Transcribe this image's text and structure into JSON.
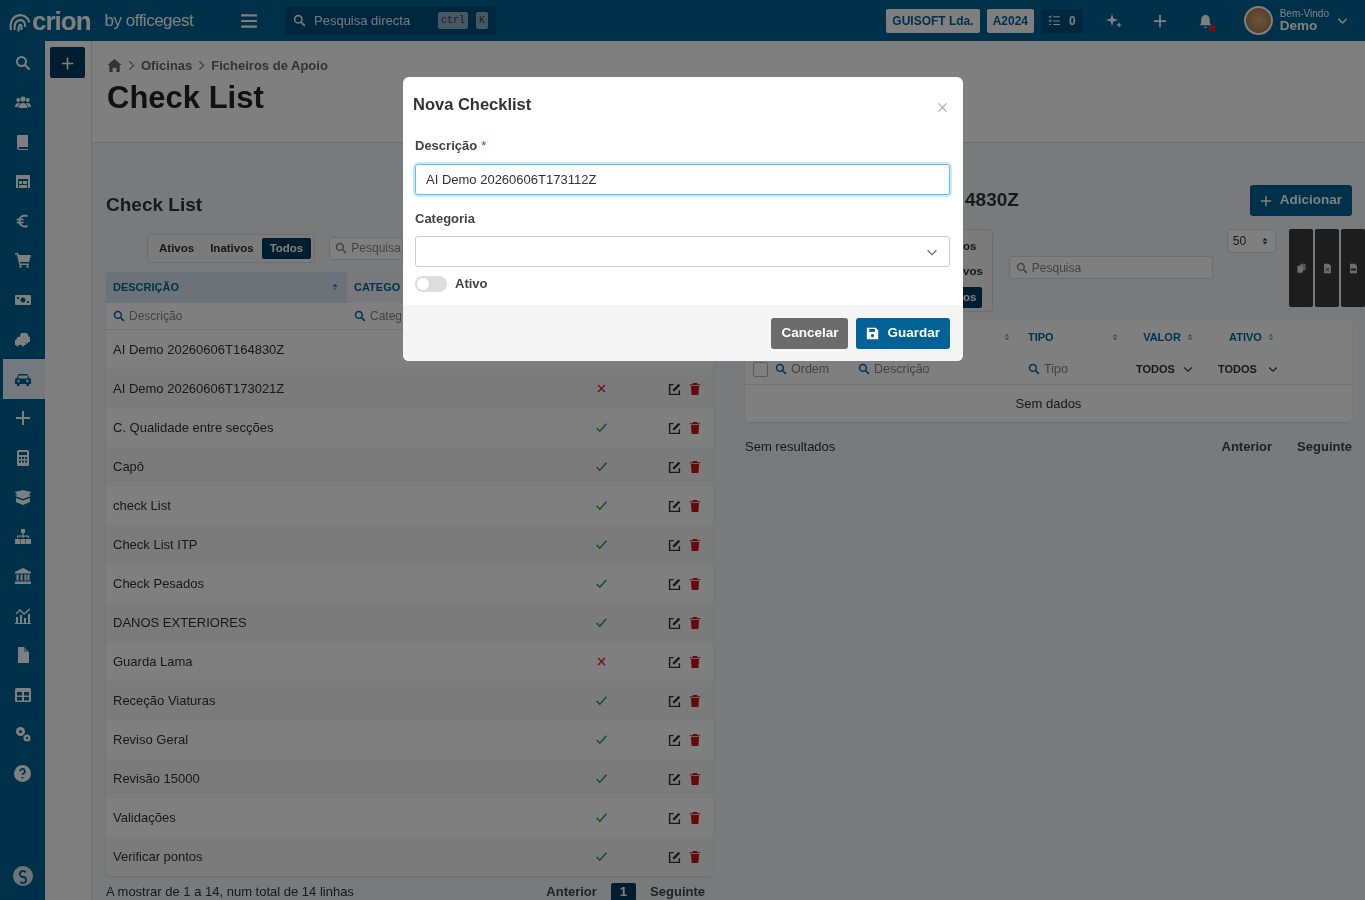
{
  "topbar": {
    "logo": "crion",
    "logo_sub": "by officegest",
    "search": {
      "placeholder": "Pesquisa directa",
      "keys": [
        "ctrl",
        "K"
      ]
    },
    "company": "GUISOFT Lda.",
    "year": "A2024",
    "tasks": "0",
    "unread_notifications": true,
    "greeting": "Bem-Vindo",
    "user": "Demo"
  },
  "sidebar": {
    "items": [
      {
        "kind": "search",
        "selected": false
      },
      {
        "kind": "users",
        "selected": false
      },
      {
        "kind": "book",
        "selected": false
      },
      {
        "kind": "warehouse",
        "selected": false
      },
      {
        "kind": "euro",
        "selected": false
      },
      {
        "kind": "cart",
        "selected": false
      },
      {
        "kind": "banknote",
        "selected": false
      },
      {
        "kind": "cars",
        "selected": false
      },
      {
        "kind": "car",
        "selected": true
      },
      {
        "kind": "plus",
        "selected": false
      },
      {
        "kind": "calculator",
        "selected": false
      },
      {
        "kind": "box",
        "selected": false
      },
      {
        "kind": "sitemap",
        "selected": false
      },
      {
        "kind": "bank",
        "selected": false
      },
      {
        "kind": "chart",
        "selected": false
      },
      {
        "kind": "file",
        "selected": false
      },
      {
        "kind": "table",
        "selected": false
      },
      {
        "kind": "gears",
        "selected": false
      },
      {
        "kind": "help",
        "selected": false
      }
    ]
  },
  "breadcrumb": [
    "Oficinas",
    "Ficheiros de Apoio"
  ],
  "page_title": "Check List",
  "left_panel": {
    "title": "Check List",
    "filters": [
      {
        "label": "Ativos",
        "selected": false
      },
      {
        "label": "Inativos",
        "selected": false
      },
      {
        "label": "Todos",
        "selected": true
      }
    ],
    "search": {
      "placeholder": "Pesquisa"
    },
    "columns": [
      {
        "label": "DESCRIÇÃO",
        "sorted": true
      },
      {
        "label": "CATEGO",
        "sorted": false
      }
    ],
    "column_filters": [
      "Descrição",
      "Categ"
    ],
    "rows": [
      {
        "description": "AI Demo 20260606T164830Z"
      },
      {
        "description": "AI Demo 20260606T173021Z",
        "active": false
      },
      {
        "description": "C. Qualidade entre secções",
        "active": true
      },
      {
        "description": "Capô",
        "active": true
      },
      {
        "description": "check List",
        "active": true
      },
      {
        "description": "Check List ITP",
        "active": true
      },
      {
        "description": "Check Pesados",
        "active": true
      },
      {
        "description": "DANOS EXTERIORES",
        "active": true
      },
      {
        "description": "Guarda Lama",
        "active": false
      },
      {
        "description": "Receção Viaturas",
        "active": true
      },
      {
        "description": "Reviso Geral",
        "active": true
      },
      {
        "description": "Revisão 15000",
        "active": true
      },
      {
        "description": "Validações",
        "active": true
      },
      {
        "description": "Verificar pontos",
        "active": true
      }
    ],
    "summary": "A mostrar de 1 a 14, num total de 14 linhas",
    "previous": "Anterior",
    "pages": [
      {
        "label": "1",
        "selected": true
      }
    ],
    "next": "Seguinte"
  },
  "right_panel": {
    "title": "4830Z",
    "add_button": "Adicionar",
    "filters": [
      {
        "label": "os",
        "selected": false
      },
      {
        "label": "vos",
        "selected": false
      },
      {
        "label": "os",
        "selected": true
      }
    ],
    "search": {
      "placeholder": "Pesquisa"
    },
    "page_size": "50",
    "exports": [
      {
        "kind": "copy"
      },
      {
        "kind": "excel"
      },
      {
        "kind": "csv"
      }
    ],
    "columns": [
      "TIPO",
      "VALOR",
      "ATIVO"
    ],
    "select_all": {
      "checked": false
    },
    "column_filters": [
      "Ordem",
      "Descrição",
      "Tipo"
    ],
    "column_selects": [
      "TODOS",
      "TODOS"
    ],
    "empty": "Sem dados",
    "summary": "Sem resultados",
    "previous": "Anterior",
    "next": "Seguinte"
  },
  "modal": {
    "title": "Nova Checklist",
    "description": {
      "label": "Descrição",
      "required_mark": "*",
      "value": "AI Demo 20260606T173112Z",
      "focused": true
    },
    "category": {
      "label": "Categoria"
    },
    "active": {
      "label": "Ativo",
      "on": false
    },
    "buttons": [
      {
        "kind": "cancel",
        "label": "Cancelar"
      },
      {
        "kind": "save",
        "label": "Guardar"
      }
    ]
  }
}
